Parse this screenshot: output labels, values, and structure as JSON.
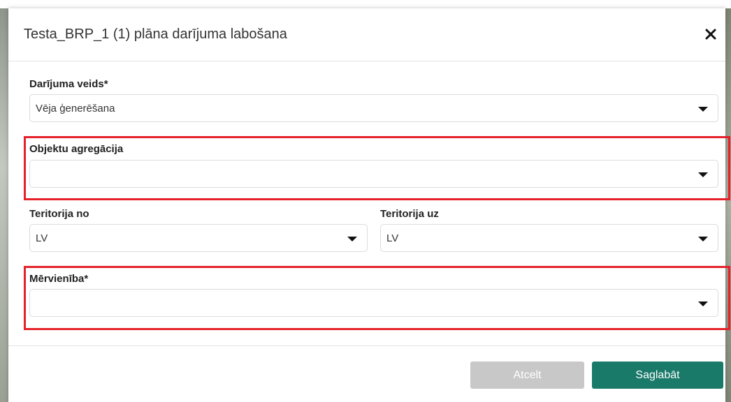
{
  "dialog": {
    "title": "Testa_BRP_1 (1) plāna darījuma labošana",
    "close_icon": "close-icon"
  },
  "form": {
    "transaction_type": {
      "label": "Darījuma veids*",
      "value": "Vēja ģenerēšana"
    },
    "object_aggregation": {
      "label": "Objektu agregācija",
      "value": ""
    },
    "territory_from": {
      "label": "Teritorija no",
      "value": "LV"
    },
    "territory_to": {
      "label": "Teritorija uz",
      "value": "LV"
    },
    "unit": {
      "label": "Mērvienība*",
      "value": ""
    }
  },
  "footer": {
    "cancel_label": "Atcelt",
    "save_label": "Saglabāt"
  },
  "colors": {
    "highlight": "#e5222a",
    "save_button": "#1a7a6a",
    "cancel_button": "#c8c8c8"
  }
}
